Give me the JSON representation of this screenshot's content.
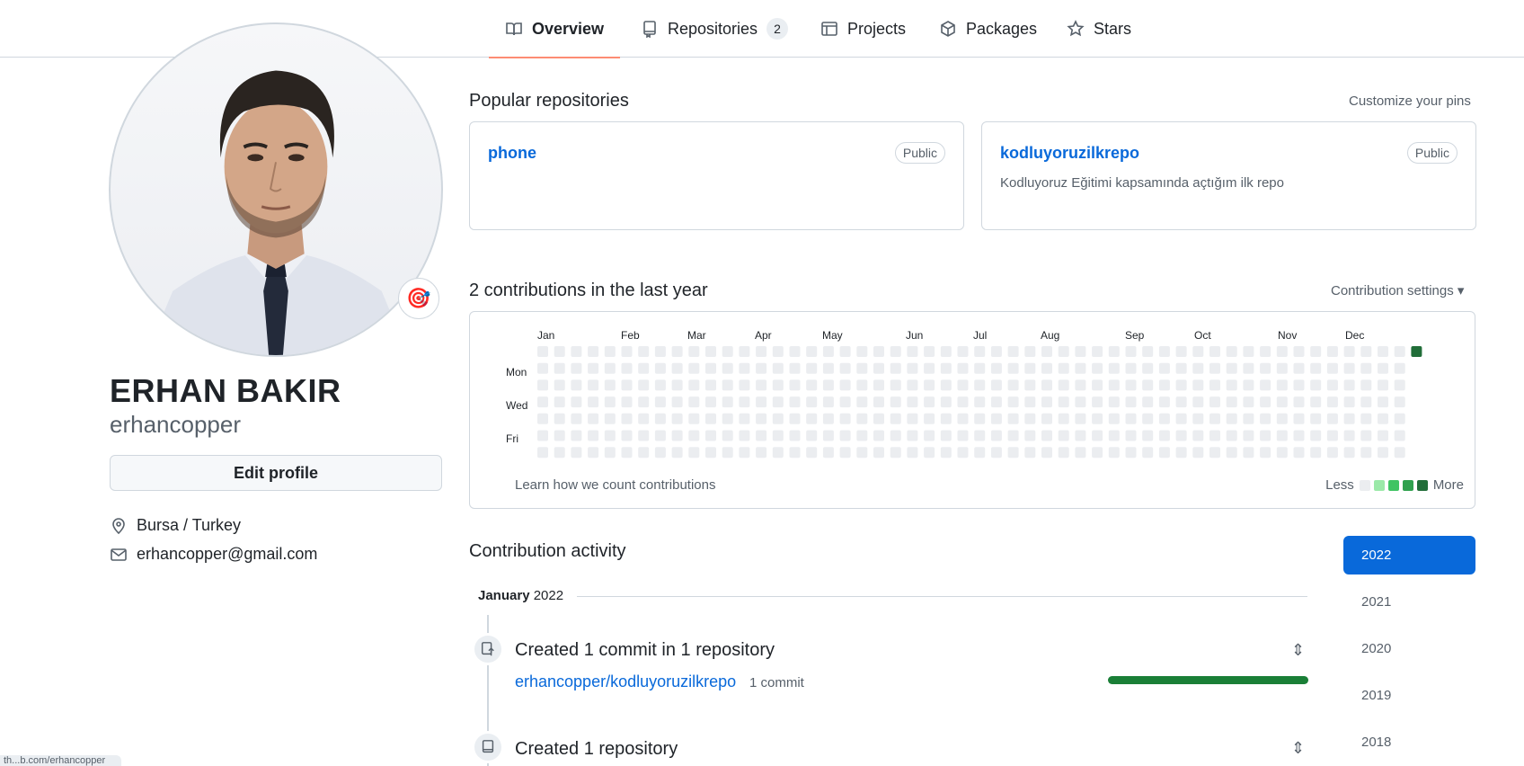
{
  "tabs": [
    {
      "label": "Overview",
      "active": true
    },
    {
      "label": "Repositories",
      "count": "2"
    },
    {
      "label": "Projects"
    },
    {
      "label": "Packages"
    },
    {
      "label": "Stars"
    }
  ],
  "profile": {
    "fullname": "ERHAN BAKIR",
    "username": "erhancopper",
    "status_emoji": "🎯",
    "edit_label": "Edit profile",
    "location": "Bursa / Turkey",
    "email": "erhancopper@gmail.com"
  },
  "popular": {
    "title": "Popular repositories",
    "customize": "Customize your pins",
    "repos": [
      {
        "name": "phone",
        "visibility": "Public",
        "description": ""
      },
      {
        "name": "kodluyoruzilkrepo",
        "visibility": "Public",
        "description": "Kodluyoruz Eğitimi kapsamında açtığım ilk repo"
      }
    ]
  },
  "contrib": {
    "title": "2 contributions in the last year",
    "settings": "Contribution settings",
    "months": [
      "Jan",
      "Feb",
      "Mar",
      "Apr",
      "May",
      "Jun",
      "Jul",
      "Aug",
      "Sep",
      "Oct",
      "Nov",
      "Dec"
    ],
    "days": [
      "Mon",
      "Wed",
      "Fri"
    ],
    "learn": "Learn how we count contributions",
    "less": "Less",
    "more": "More",
    "empty_color": "#ebedf0",
    "levels": [
      "#ebedf0",
      "#9be9a8",
      "#40c463",
      "#30a14e",
      "#216e39"
    ]
  },
  "activity": {
    "title": "Contribution activity",
    "month": "January",
    "year": "2022",
    "items": [
      {
        "title": "Created 1 commit in 1 repository",
        "repo": "erhancopper/kodluyoruzilkrepo",
        "count": "1 commit"
      },
      {
        "title": "Created 1 repository"
      }
    ]
  },
  "years": [
    "2022",
    "2021",
    "2020",
    "2019",
    "2018"
  ],
  "status_bar": "th...b.com/erhancopper"
}
